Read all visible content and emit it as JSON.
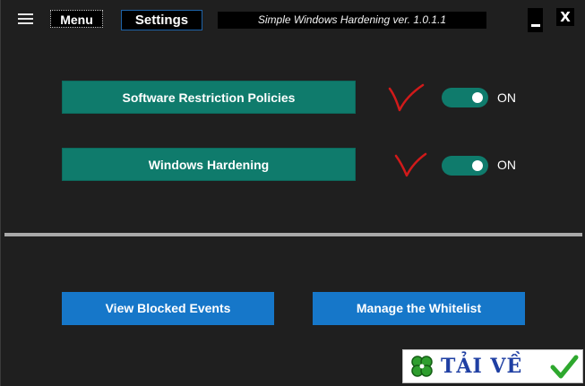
{
  "topbar": {
    "menu_label": "Menu",
    "settings_label": "Settings",
    "title": "Simple Windows Hardening ver. 1.0.1.1",
    "close_label": "X"
  },
  "policies": [
    {
      "label": "Software Restriction Policies",
      "toggle_state": "ON"
    },
    {
      "label": "Windows Hardening",
      "toggle_state": "ON"
    }
  ],
  "actions": {
    "view_blocked_label": "View Blocked Events",
    "manage_whitelist_label": "Manage the Whitelist"
  },
  "watermark": {
    "text": "TẢI VỀ"
  },
  "colors": {
    "background": "#1f1f1f",
    "teal": "#0f7b6c",
    "blue": "#1677c9",
    "annotation_red": "#d11a1a"
  }
}
